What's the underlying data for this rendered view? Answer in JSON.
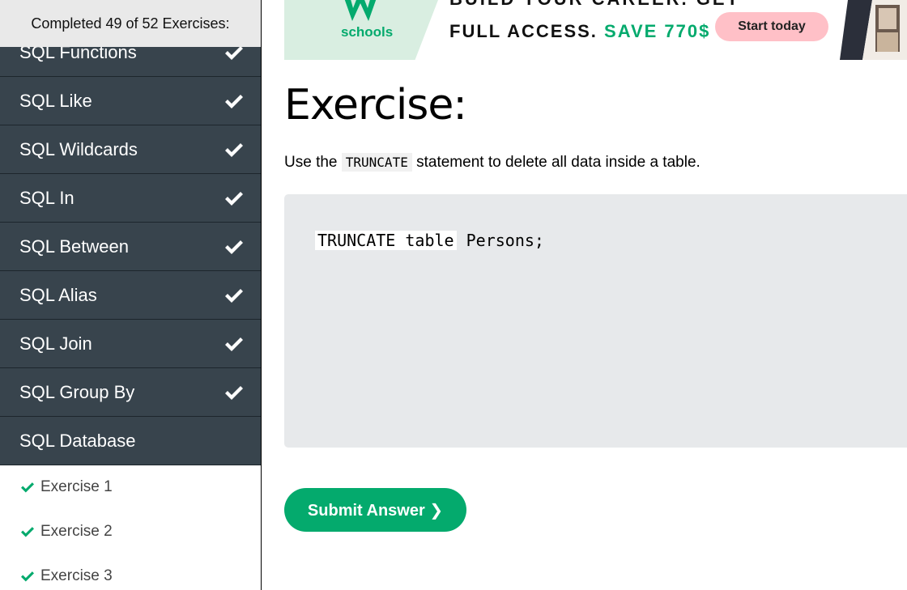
{
  "sidebar": {
    "progress_text": "Completed 49 of 52 Exercises:",
    "categories": [
      {
        "label": "SQL Functions",
        "done": true
      },
      {
        "label": "SQL Like",
        "done": true
      },
      {
        "label": "SQL Wildcards",
        "done": true
      },
      {
        "label": "SQL In",
        "done": true
      },
      {
        "label": "SQL Between",
        "done": true
      },
      {
        "label": "SQL Alias",
        "done": true
      },
      {
        "label": "SQL Join",
        "done": true
      },
      {
        "label": "SQL Group By",
        "done": true
      },
      {
        "label": "SQL Database",
        "done": false
      }
    ],
    "exercises": [
      {
        "label": "Exercise 1",
        "done": true
      },
      {
        "label": "Exercise 2",
        "done": true
      },
      {
        "label": "Exercise 3",
        "done": true
      }
    ]
  },
  "ad": {
    "logo_text": "schools",
    "line1": "BUILD YOUR CAREER. GET",
    "line2_prefix": "FULL ACCESS.",
    "line2_accent": "SAVE 770$",
    "cta_label": "Start today"
  },
  "main": {
    "heading": "Exercise:",
    "instruction_before": "Use the",
    "instruction_code": "TRUNCATE",
    "instruction_after": "statement to delete all data inside a table.",
    "code_prefix": "",
    "code_input_value": "TRUNCATE table",
    "code_suffix": " Persons;",
    "submit_label": "Submit Answer ❯"
  },
  "colors": {
    "accent": "#04aa6d",
    "sidebar_bg": "#38444d",
    "code_bg": "#e7e9eb",
    "cta_bg": "#ffc0c7"
  },
  "icons": {
    "check": "check-icon"
  }
}
